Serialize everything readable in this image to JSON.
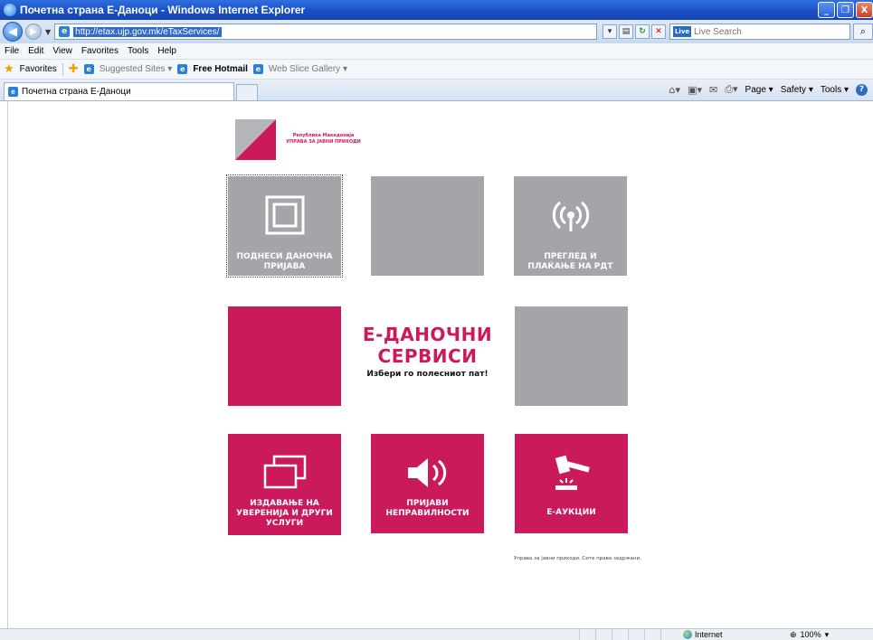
{
  "window": {
    "title": "Почетна страна Е-Даноци - Windows Internet Explorer",
    "minimize": "_",
    "maximize": "❐",
    "close": "X"
  },
  "address": {
    "url": "http://etax.ujp.gov.mk/eTaxServices/",
    "search_placeholder": "Live Search",
    "live_badge": "Live"
  },
  "menu": [
    "File",
    "Edit",
    "View",
    "Favorites",
    "Tools",
    "Help"
  ],
  "favorites": {
    "label": "Favorites",
    "links": [
      "Suggested Sites ▾",
      "Free Hotmail",
      "Web Slice Gallery ▾"
    ]
  },
  "tab": {
    "title": "Почетна страна Е-Даноци"
  },
  "commandbar": {
    "page": "Page ▾",
    "safety": "Safety ▾",
    "tools": "Tools ▾",
    "help": "?"
  },
  "logo": {
    "line1": "Република Македонија",
    "line2": "УПРАВА ЗА ЈАВНИ ПРИХОДИ"
  },
  "tiles": {
    "file": "ПОДНЕСИ ДАНОЧНА ПРИЈАВА",
    "pay": "ПРЕГЛЕД И ПЛАЌАЊЕ НА РДТ",
    "cert": "ИЗДАВАЊЕ НА УВЕРЕНИЈА И ДРУГИ УСЛУГИ",
    "report": "ПРИЈАВИ НЕПРАВИЛНОСТИ",
    "auction": "Е-АУКЦИИ"
  },
  "center": {
    "title_line1": "Е-ДАНОЧНИ",
    "title_line2": "СЕРВИСИ",
    "subtitle": "Избери го полесниот пат!"
  },
  "footer": {
    "copyright": "Управа за јавни приходи. Сите права задржани."
  },
  "status": {
    "zone": "Internet",
    "zoom": "100%"
  },
  "colors": {
    "brand_pink": "#cb1a5c",
    "tile_grey": "#a3a5a8"
  }
}
